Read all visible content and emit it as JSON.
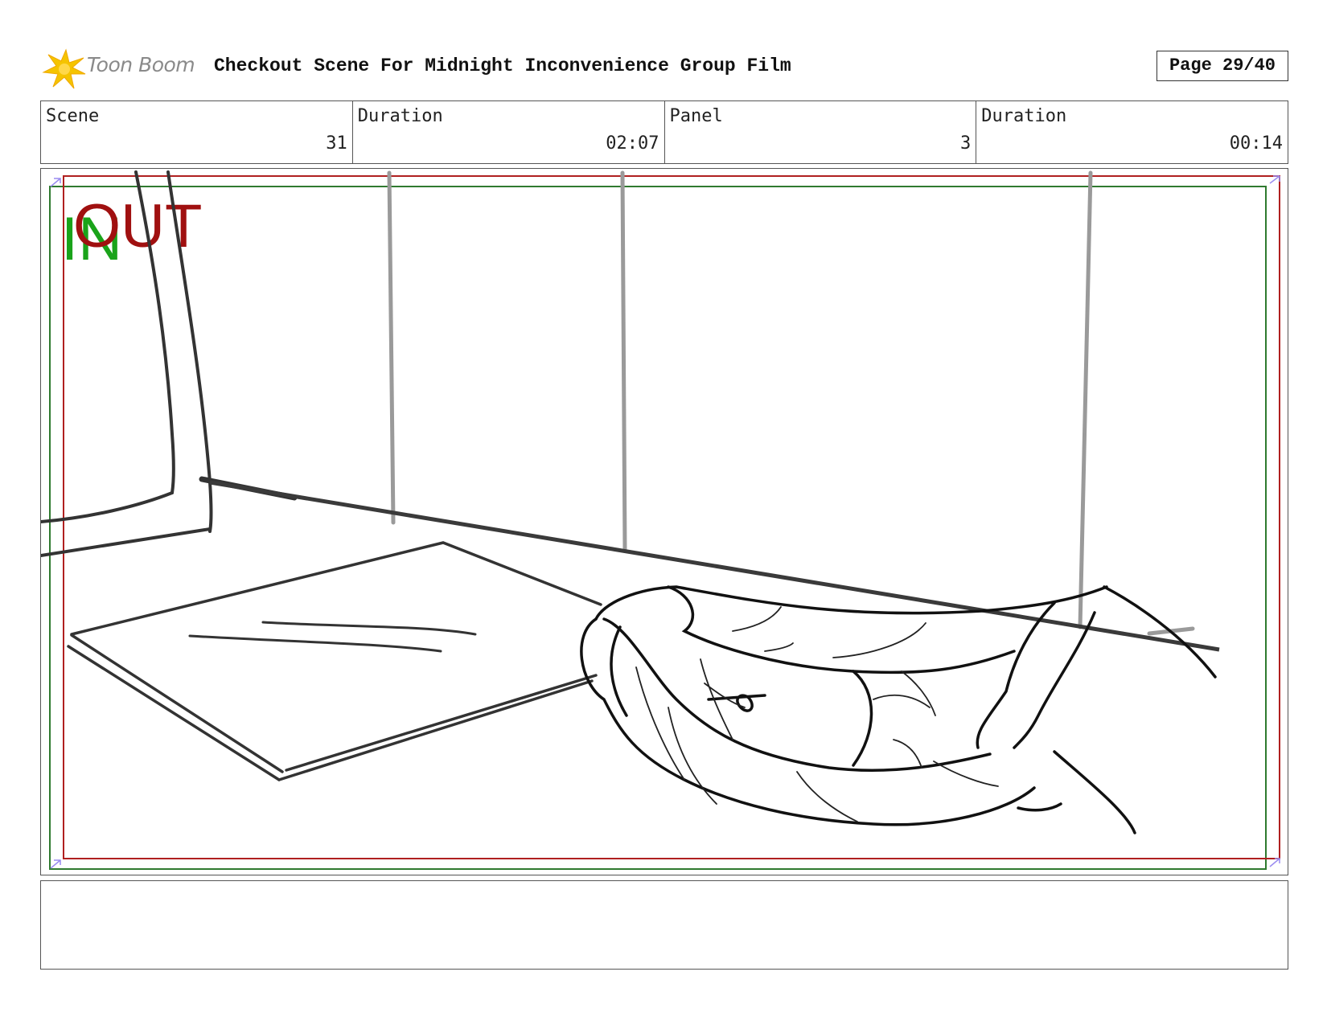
{
  "header": {
    "logo_text": "Toon Boom",
    "title": "Checkout Scene For Midnight Inconvenience Group Film",
    "page": "Page 29/40"
  },
  "info": [
    {
      "label": "Scene",
      "value": "31"
    },
    {
      "label": "Duration",
      "value": "02:07"
    },
    {
      "label": "Panel",
      "value": "3"
    },
    {
      "label": "Duration",
      "value": "00:14"
    }
  ],
  "panel": {
    "in_label": "IN",
    "out_label": "OUT",
    "in_color": "#1aa31a",
    "out_color": "#a01010"
  },
  "notes": {
    "text": ""
  }
}
